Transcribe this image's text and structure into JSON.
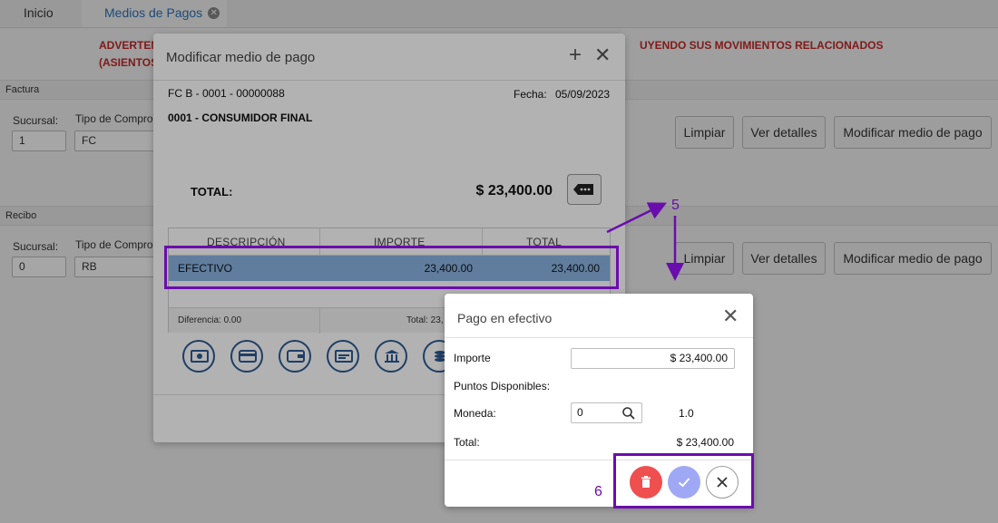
{
  "tabs": [
    {
      "label": "Inicio"
    },
    {
      "label": "Medios de Pagos"
    }
  ],
  "warning": {
    "line1_left": "ADVERTEN",
    "line1_right": "UYENDO SUS MOVIMIENTOS RELACIONADOS",
    "line2_left": "(ASIENTOS"
  },
  "factura": {
    "section_label": "Factura",
    "sucursal_label": "Sucursal:",
    "sucursal_value": "1",
    "tipo_label": "Tipo de Comprob",
    "tipo_value": "FC"
  },
  "recibo": {
    "section_label": "Recibo",
    "sucursal_label": "Sucursal:",
    "sucursal_value": "0",
    "tipo_label": "Tipo de Comprob",
    "tipo_value": "RB"
  },
  "buttons": {
    "limpiar": "Limpiar",
    "ver_detalles": "Ver detalles",
    "modificar": "Modificar medio de pago"
  },
  "modal1": {
    "title": "Modificar medio de pago",
    "comprobante": "FC B - 0001 - 00000088",
    "fecha_label": "Fecha:",
    "fecha_value": "05/09/2023",
    "cliente": "0001 - CONSUMIDOR FINAL",
    "total_label": "TOTAL:",
    "total_value": "$ 23,400.00",
    "grid": {
      "headers": [
        "DESCRIPCIÓN",
        "IMPORTE",
        "TOTAL"
      ],
      "rows": [
        {
          "descripcion": "EFECTIVO",
          "importe": "23,400.00",
          "total": "23,400.00"
        }
      ],
      "footer_diferencia": "Diferencia: 0.00",
      "footer_total": "Total: 23,"
    },
    "payment_icons": [
      "cash-icon",
      "credit-card-icon",
      "wallet-icon",
      "check-icon",
      "bank-icon",
      "coins-icon"
    ]
  },
  "modal2": {
    "title": "Pago en efectivo",
    "importe_label": "Importe",
    "importe_value": "$ 23,400.00",
    "puntos_label": "Puntos Disponibles:",
    "moneda_label": "Moneda:",
    "moneda_value": "0",
    "cotizacion": "1.0",
    "total_label": "Total:",
    "total_value": "$ 23,400.00"
  },
  "annotations": {
    "step5": "5",
    "step6": "6"
  },
  "colors": {
    "highlight": "#6a0dad",
    "link": "#2f72b6",
    "warning": "#c62828",
    "delete": "#ef4f4f",
    "confirm": "#9fa8f5",
    "selected_row": "#8ab4e3"
  }
}
